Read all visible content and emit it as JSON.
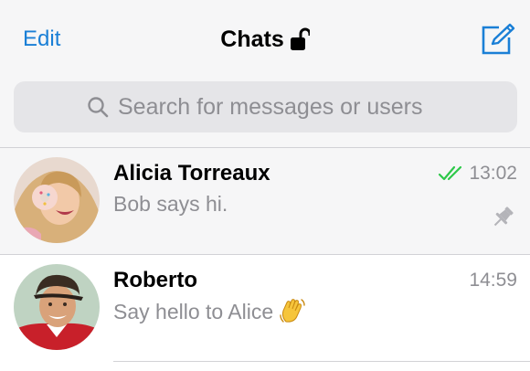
{
  "header": {
    "edit_label": "Edit",
    "title": "Chats",
    "title_icon": "lock-open-icon",
    "compose_icon": "compose-icon",
    "accent_color": "#1a7fd6"
  },
  "search": {
    "placeholder": "Search for messages or users",
    "icon": "search-icon"
  },
  "chats": [
    {
      "name": "Alicia Torreaux",
      "preview": "Bob says hi.",
      "time": "13:02",
      "status": "read",
      "status_icon": "double-check-icon",
      "status_color": "#2ec84a",
      "pinned": true,
      "pin_icon": "pin-icon"
    },
    {
      "name": "Roberto",
      "preview": "Say hello to Alice",
      "preview_emoji_icon": "waving-hand-icon",
      "time": "14:59"
    }
  ]
}
